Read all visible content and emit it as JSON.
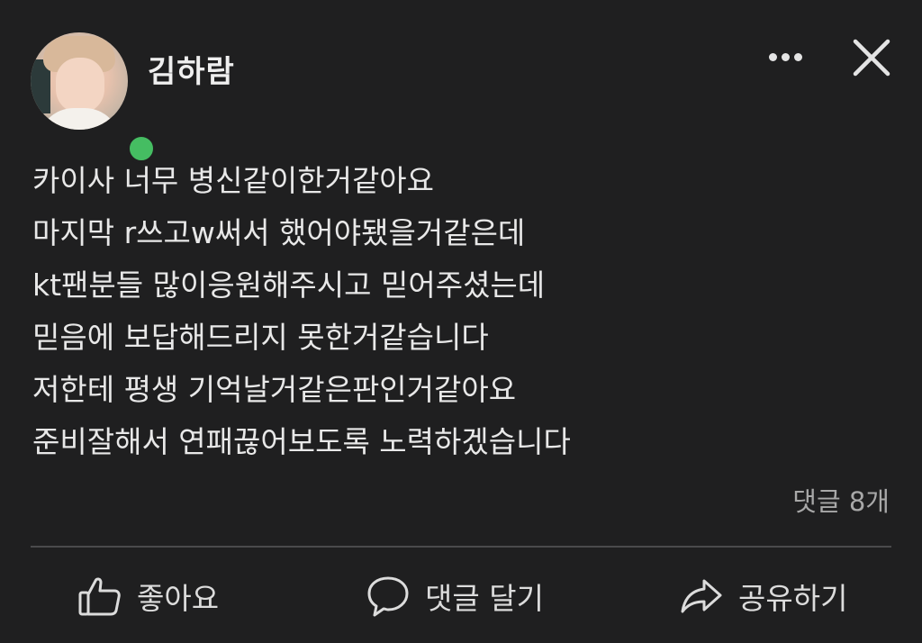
{
  "author": {
    "name": "김하람",
    "online": true,
    "online_color": "#45bd62"
  },
  "header": {
    "more_icon": "more-horizontal-icon",
    "close_icon": "close-icon"
  },
  "post": {
    "lines": [
      "카이사 너무 병신같이한거같아요",
      "마지막 r쓰고w써서 했어야됐을거같은데",
      "kt팬분들 많이응원해주시고 믿어주셨는데",
      "믿음에 보답해드리지 못한거같습니다",
      "저한테 평생 기억날거같은판인거같아요",
      "준비잘해서 연패끊어보도록 노력하겠습니다"
    ]
  },
  "comments": {
    "count_label": "댓글 8개"
  },
  "actions": {
    "like_label": "좋아요",
    "comment_label": "댓글 달기",
    "share_label": "공유하기"
  },
  "colors": {
    "background": "#1f1f20",
    "text": "#e8e8e8",
    "muted": "#a8a8a8",
    "divider": "#4a4a4c"
  }
}
